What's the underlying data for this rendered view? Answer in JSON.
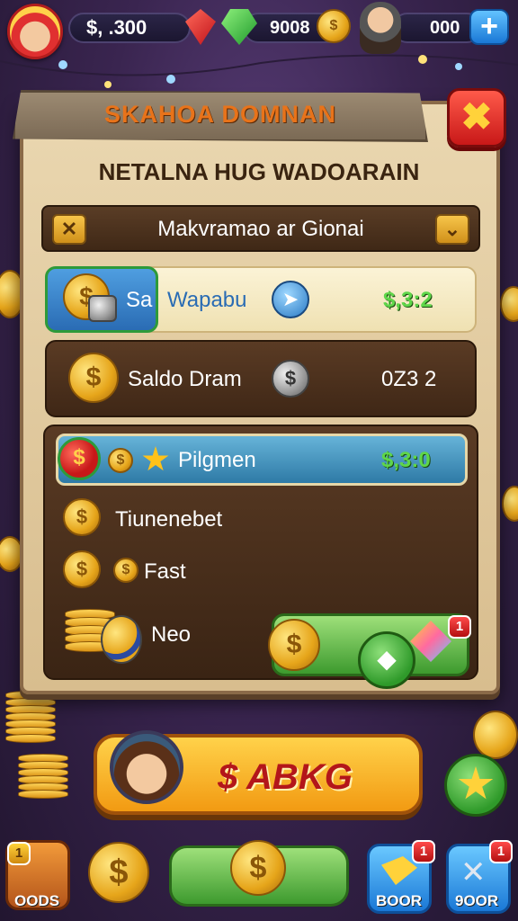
{
  "topbar": {
    "gold_amount": "$, .300",
    "gem_amount": "9008",
    "premium_amount": "000",
    "coin_symbol": "$",
    "plus_symbol": "+"
  },
  "panel": {
    "title": "SKAHOA DOMNAN",
    "close_symbol": "✖",
    "subtitle": "NETALNA HUG WADOARAIN"
  },
  "dropdown": {
    "left_symbol": "✕",
    "label": "Makvramao ar Gionai",
    "chevron_symbol": "⌄"
  },
  "rows": {
    "row1": {
      "tab_label": "Sa",
      "label": "Wapabu",
      "value": "$,3:2"
    },
    "row2": {
      "label": "Saldo Dram",
      "value": "0Z3 2"
    },
    "row3": {
      "label": "Pilgmen",
      "value": "$,3:0"
    },
    "row4": {
      "label": "Tiunenebet"
    },
    "row5": {
      "label": "Fast"
    },
    "row6": {
      "label": "Neo",
      "badge": "1"
    }
  },
  "main_button": {
    "label": "$ ABKG"
  },
  "bottom_nav": {
    "left_label": "OODS",
    "left_badge": "1",
    "shop_label": "BOOR",
    "shop_badge": "1",
    "tools_label": "9OOR",
    "tools_badge": "1"
  },
  "colors": {
    "accent_orange": "#e8731a",
    "value_green": "#5fd64a",
    "close_red": "#c81818",
    "button_gold": "#f29a12"
  }
}
